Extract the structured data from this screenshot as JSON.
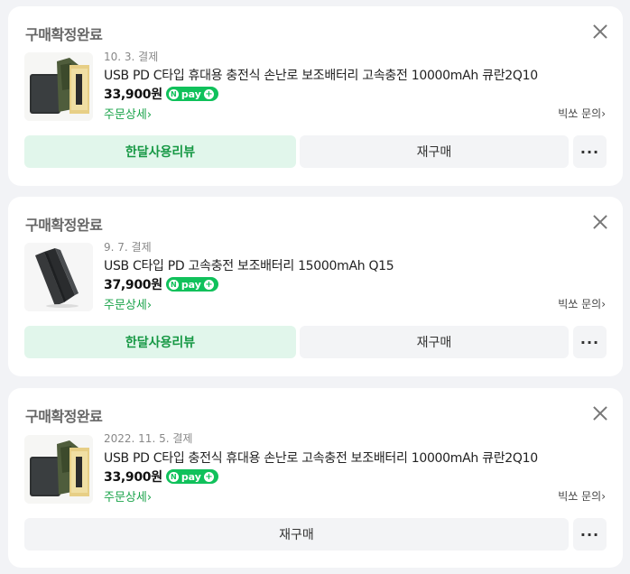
{
  "orders": [
    {
      "status": "구매확정완료",
      "date": "10. 3. 결제",
      "title": "USB PD C타입 휴대용 충전식 손난로 보조배터리 고속충전 10000mAh 큐란2Q10",
      "price": "33,900원",
      "detail_label": "주문상세",
      "inquiry_label": "빅쏘 문의",
      "review_label": "한달사용리뷰",
      "rebuy_label": "재구매",
      "more_label": "···",
      "image": "powerbank-green-box"
    },
    {
      "status": "구매확정완료",
      "date": "9. 7. 결제",
      "title": "USB C타입 PD 고속충전 보조배터리 15000mAh Q15",
      "price": "37,900원",
      "detail_label": "주문상세",
      "inquiry_label": "빅쏘 문의",
      "review_label": "한달사용리뷰",
      "rebuy_label": "재구매",
      "more_label": "···",
      "image": "powerbank-dark"
    },
    {
      "status": "구매확정완료",
      "date": "2022. 11. 5. 결제",
      "title": "USB PD C타입 충전식 휴대용 손난로 고속충전 보조배터리 10000mAh 큐란2Q10",
      "price": "33,900원",
      "detail_label": "주문상세",
      "inquiry_label": "빅쏘 문의",
      "rebuy_label": "재구매",
      "more_label": "···",
      "image": "powerbank-green-box"
    }
  ],
  "npay": {
    "n": "N",
    "text": "pay",
    "plus": "+"
  },
  "colors": {
    "accent_green": "#1aa34a",
    "review_bg": "#e1f6eb",
    "npay_green": "#10c15b"
  }
}
